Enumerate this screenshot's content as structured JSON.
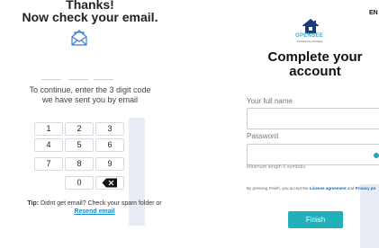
{
  "left": {
    "title_line1": "Thanks!",
    "title_line2": "Now check your email.",
    "instruction": "To continue, enter the 3 digit code we have sent you by email",
    "keypad": [
      "1",
      "2",
      "3",
      "4",
      "5",
      "6",
      "7",
      "8",
      "9",
      "0"
    ],
    "tip_label": "Tip:",
    "tip_text": " Didnt get email? Check your spam folder or ",
    "resend_link": "Resend email"
  },
  "right": {
    "language": "EN",
    "brand_name": "OPENSEE",
    "brand_sub": "Powered by Airbridge",
    "title_line1": "Complete your",
    "title_line2": "account",
    "full_name_label": "Your full name",
    "full_name_value": "",
    "password_label": "Password",
    "password_value": "",
    "password_hint": "Minimum length 6 symbols.",
    "terms_prefix": "By pressing Finish, you accept the ",
    "terms_agreement": "License agreement",
    "terms_and": " and ",
    "terms_privacy": "Privacy po",
    "finish_label": "Finish",
    "accent_color": "#22b0ba"
  }
}
